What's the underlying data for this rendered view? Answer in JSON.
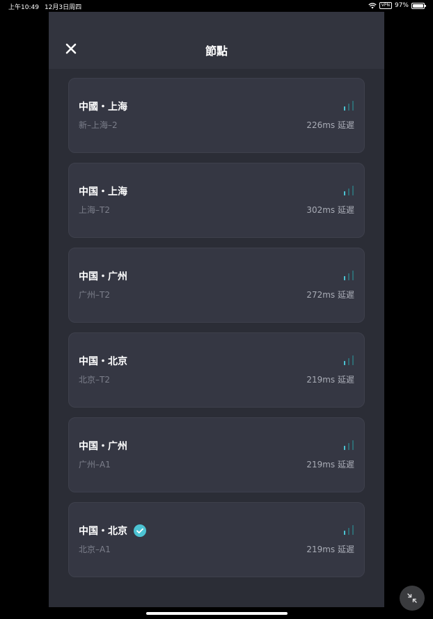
{
  "status_bar": {
    "time": "上午10:49",
    "date": "12月3日周四",
    "vpn_label": "VPN",
    "battery_text": "97%",
    "battery_level": 0.97
  },
  "header": {
    "title": "節點",
    "close_icon": "close-icon"
  },
  "nodes": [
    {
      "name": "中國・上海",
      "server": "新–上海–2",
      "latency": "226ms 延遲",
      "selected": false
    },
    {
      "name": "中国・上海",
      "server": "上海–T2",
      "latency": "302ms 延遲",
      "selected": false
    },
    {
      "name": "中国・广州",
      "server": "广州–T2",
      "latency": "272ms 延遲",
      "selected": false
    },
    {
      "name": "中国・北京",
      "server": "北京–T2",
      "latency": "219ms 延遲",
      "selected": false
    },
    {
      "name": "中国・广州",
      "server": "广州–A1",
      "latency": "219ms 延遲",
      "selected": false
    },
    {
      "name": "中国・北京",
      "server": "北京–A1",
      "latency": "219ms 延遲",
      "selected": true
    }
  ],
  "colors": {
    "accent": "#4cc3d3",
    "sheet_bg": "#2b2d36",
    "card_bg": "#353743",
    "signal_dim": "#2f6a73"
  }
}
